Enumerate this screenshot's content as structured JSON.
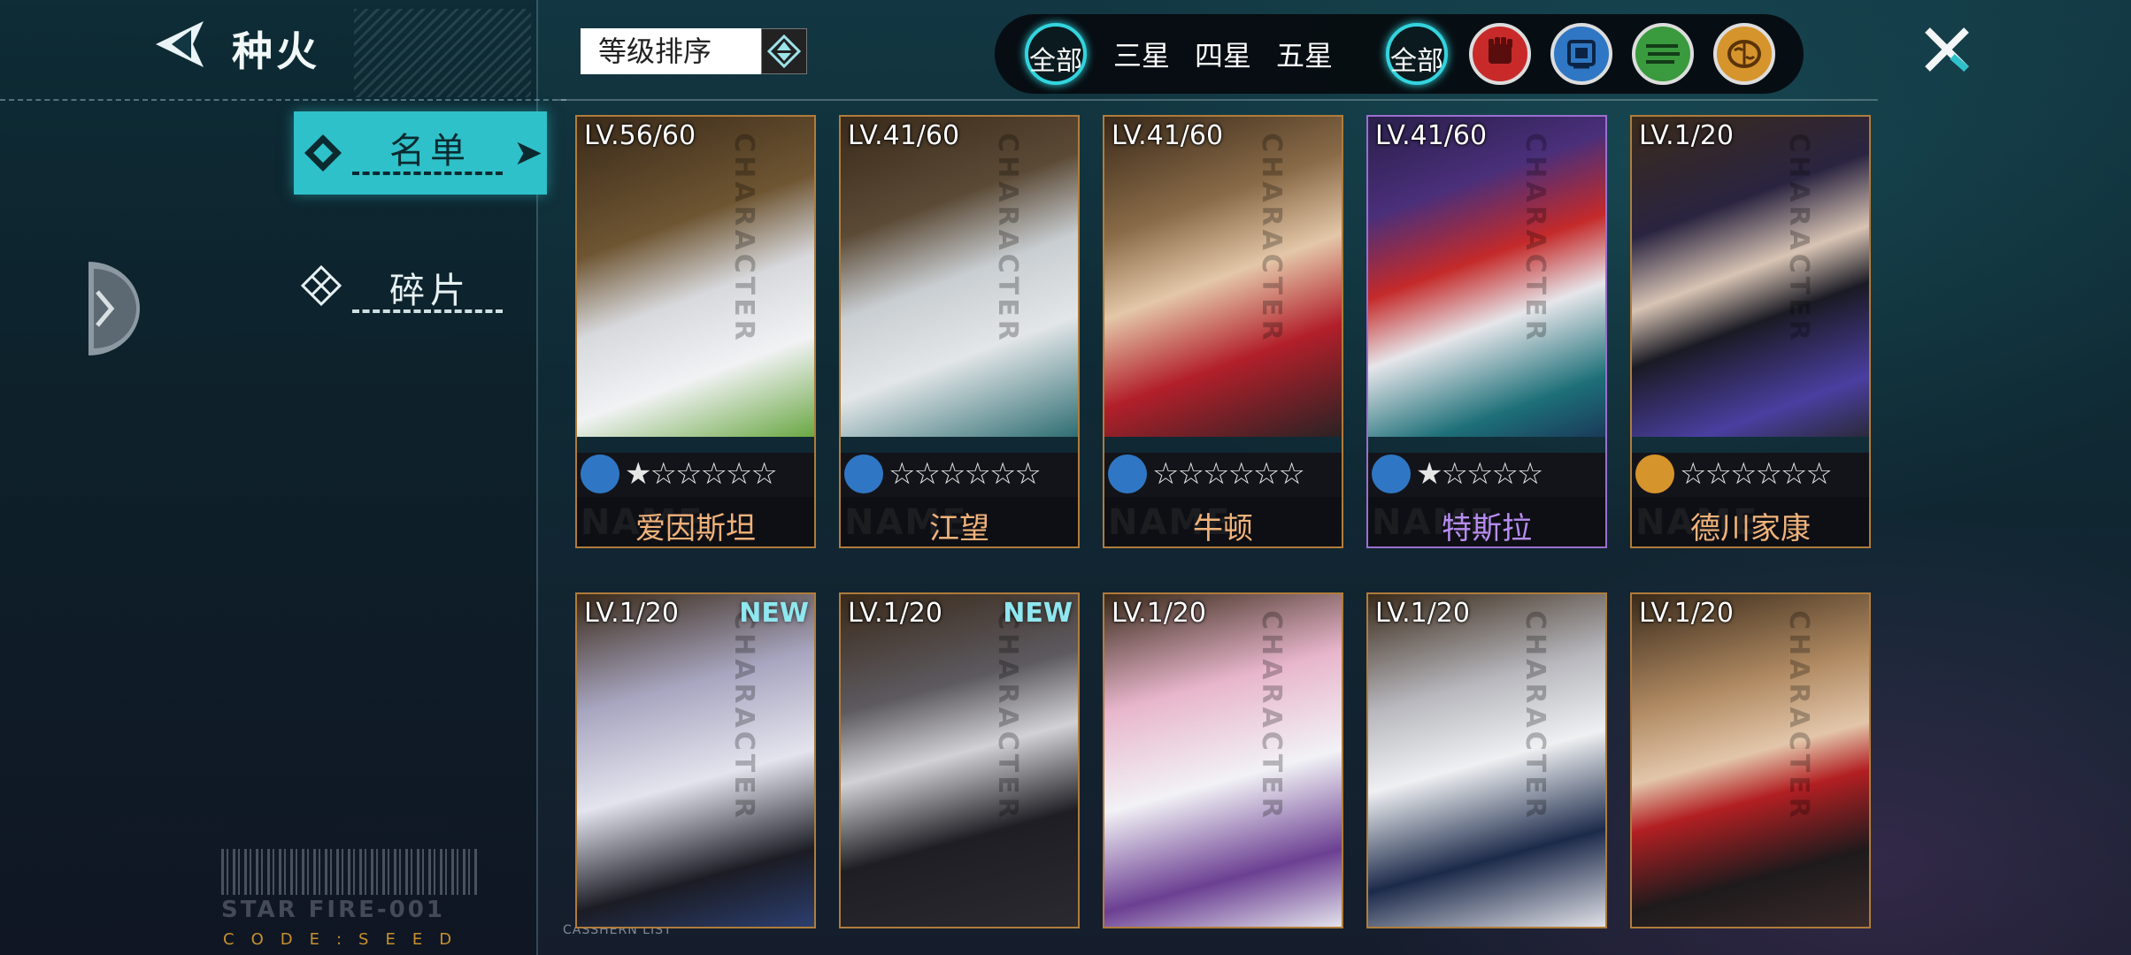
{
  "header": {
    "title": "种火"
  },
  "nav": {
    "roster_label": "名单",
    "shards_label": "碎片"
  },
  "sort": {
    "label": "等级排序"
  },
  "filters": {
    "all_stars": "全部",
    "three_star": "三星",
    "four_star": "四星",
    "five_star": "五星",
    "all_classes": "全部",
    "class_icons": [
      "fist-icon",
      "chip-icon",
      "circuit-icon",
      "brain-icon"
    ]
  },
  "cards_row1": [
    {
      "level": "LV.56/60",
      "name": "爱因斯坦",
      "class_icon": "chip-icon",
      "stars_filled": 1,
      "stars_total": 6,
      "stars": "★☆☆☆☆☆"
    },
    {
      "level": "LV.41/60",
      "name": "江望",
      "class_icon": "chip-icon",
      "stars_filled": 0,
      "stars_total": 6,
      "stars": "☆☆☆☆☆☆"
    },
    {
      "level": "LV.41/60",
      "name": "牛顿",
      "class_icon": "chip-icon",
      "stars_filled": 0,
      "stars_total": 6,
      "stars": "☆☆☆☆☆☆"
    },
    {
      "level": "LV.41/60",
      "name": "特斯拉",
      "class_icon": "chip-icon",
      "stars_filled": 1,
      "stars_total": 5,
      "stars": "★☆☆☆☆"
    },
    {
      "level": "LV.1/20",
      "name": "德川家康",
      "class_icon": "brain-icon",
      "stars_filled": 0,
      "stars_total": 6,
      "stars": "☆☆☆☆☆☆"
    }
  ],
  "cards_row2": [
    {
      "level": "LV.1/20",
      "badge": "NEW"
    },
    {
      "level": "LV.1/20",
      "badge": "NEW"
    },
    {
      "level": "LV.1/20",
      "badge": ""
    },
    {
      "level": "LV.1/20",
      "badge": ""
    },
    {
      "level": "LV.1/20",
      "badge": ""
    }
  ],
  "decor": {
    "star_fire": "STAR FIRE-001",
    "code_seed": "CODE:SEED",
    "casshern": "CASSHERN LIST",
    "card_watermark": "CHARACTER",
    "name_watermark": "NAME"
  },
  "colors": {
    "accent": "#2fc1c9",
    "card_border": "#b07c3a",
    "card_border_purple": "#9b6fd0",
    "name_orange": "#f0b27a",
    "name_purple": "#b78cf2"
  }
}
